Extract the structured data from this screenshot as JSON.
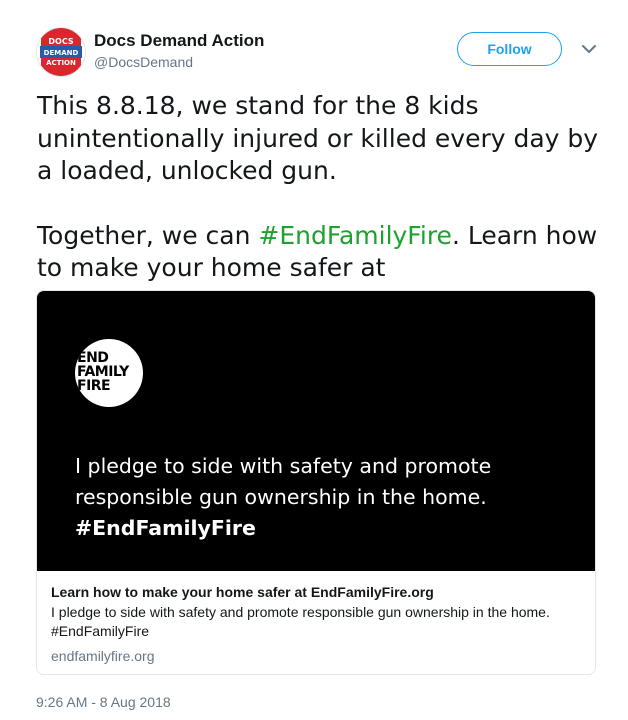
{
  "account": {
    "display_name": "Docs Demand Action",
    "handle": "@DocsDemand",
    "avatar_text": [
      "DOCS",
      "DEMAND",
      "ACTION"
    ],
    "avatar_colors": {
      "blue": "#2b5aa8",
      "red": "#d8282d"
    }
  },
  "header": {
    "follow_label": "Follow",
    "more_icon": "chevron-down-icon"
  },
  "tweet": {
    "line1": "This 8.8.18, we stand for the 8 kids unintentionally injured or killed every day by a loaded, unlocked gun.",
    "line2_before": "Together, we can ",
    "hashtag": "#EndFamilyFire",
    "line2_after": ". Learn how to make your home safer at"
  },
  "card": {
    "logo_lines": [
      "END",
      "FAMILY",
      "FIRE"
    ],
    "image_text_plain": "I pledge to side with safety and promote responsible gun ownership in the home. ",
    "image_text_tag": "#EndFamilyFire",
    "title": "Learn how to make your home safer at EndFamilyFire.org",
    "description": "I pledge to side with safety and promote responsible gun ownership in the home. #EndFamilyFire",
    "domain": "endfamilyfire.org"
  },
  "timestamp": "9:26 AM - 8 Aug 2018",
  "colors": {
    "accent_blue": "#1da1f2",
    "hashtag_green": "#1da12f",
    "muted_gray": "#657786",
    "border": "#e1e8ed"
  }
}
